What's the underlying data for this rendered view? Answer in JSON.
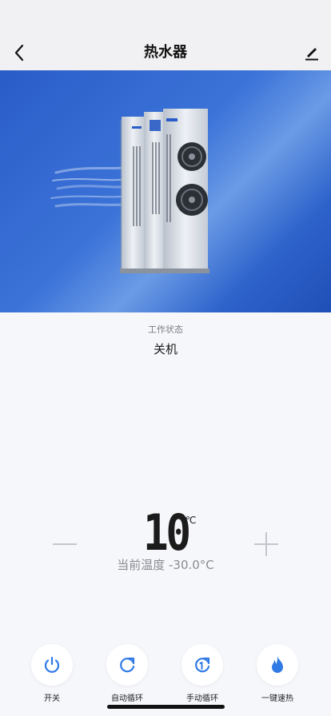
{
  "nav": {
    "title": "热水器"
  },
  "status": {
    "label": "工作状态",
    "value": "关机"
  },
  "temperature": {
    "set": "10",
    "unit": "℃",
    "current": "当前温度 -30.0°C"
  },
  "controls": [
    {
      "label": "开关",
      "icon": "power-icon"
    },
    {
      "label": "自动循环",
      "icon": "refresh-icon"
    },
    {
      "label": "手动循环",
      "icon": "manual-cycle-icon"
    },
    {
      "label": "一键速热",
      "icon": "flame-icon"
    }
  ],
  "colors": {
    "accent": "#2f7ae5",
    "hero_bg": "#2e63cb"
  }
}
